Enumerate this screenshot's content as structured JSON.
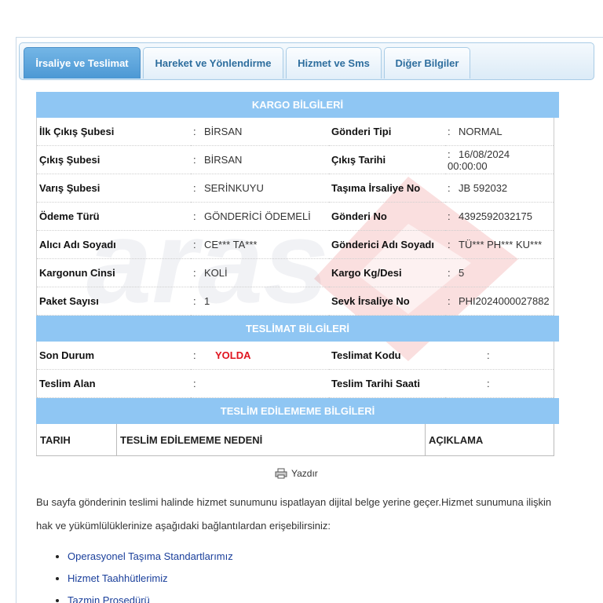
{
  "tabs": [
    {
      "label": "İrsaliye ve Teslimat",
      "active": true
    },
    {
      "label": "Hareket ve Yönlendirme",
      "active": false
    },
    {
      "label": "Hizmet ve Sms",
      "active": false
    },
    {
      "label": "Diğer Bilgiler",
      "active": false
    }
  ],
  "cargo": {
    "title": "KARGO BİLGİLERİ",
    "rows": [
      {
        "l1": "İlk Çıkış Şubesi",
        "v1": "BİRSAN",
        "l2": "Gönderi Tipi",
        "v2": "NORMAL"
      },
      {
        "l1": "Çıkış Şubesi",
        "v1": "BİRSAN",
        "l2": "Çıkış Tarihi",
        "v2": "16/08/2024 00:00:00"
      },
      {
        "l1": "Varış Şubesi",
        "v1": "SERİNKUYU",
        "l2": "Taşıma İrsaliye No",
        "v2": "JB 592032"
      },
      {
        "l1": "Ödeme Türü",
        "v1": "GÖNDERİCİ ÖDEMELİ",
        "l2": "Gönderi No",
        "v2": "4392592032175"
      },
      {
        "l1": "Alıcı Adı Soyadı",
        "v1": "CE*** TA***",
        "l2": "Gönderici Adı Soyadı",
        "v2": "TÜ*** PH*** KU***"
      },
      {
        "l1": "Kargonun Cinsi",
        "v1": "KOLİ",
        "l2": "Kargo Kg/Desi",
        "v2": "5"
      },
      {
        "l1": "Paket Sayısı",
        "v1": "1",
        "l2": "Sevk İrsaliye No",
        "v2": "PHI2024000027882"
      }
    ]
  },
  "delivery": {
    "title": "TESLİMAT BİLGİLERİ",
    "status_label": "Son Durum",
    "status_value": "YOLDA",
    "code_label": "Teslimat Kodu",
    "receiver_label": "Teslim Alan",
    "datetime_label": "Teslim Tarihi Saati",
    "colon": ":"
  },
  "undelivered": {
    "title": "TESLİM EDİLEMEME BİLGİLERİ",
    "columns": [
      "TARIH",
      "TESLİM EDİLEMEME NEDENİ",
      "AÇIKLAMA"
    ]
  },
  "print_label": "Yazdır",
  "note_line1": "Bu sayfa gönderinin teslimi halinde hizmet sunumunu ispatlayan dijital belge yerine geçer.Hizmet sunumuna ilişkin",
  "note_line2": "hak ve yükümlülüklerinize aşağıdaki bağlantılardan erişebilirsiniz:",
  "links": [
    "Operasyonel Taşıma Standartlarımız",
    "Hizmet Taahhütlerimiz",
    "Tazmin Prosedürü"
  ],
  "colors": {
    "accent": "#8fc6f3",
    "tab_active": "#4c98d4",
    "status": "#e0141e",
    "link": "#1a3f9b"
  }
}
